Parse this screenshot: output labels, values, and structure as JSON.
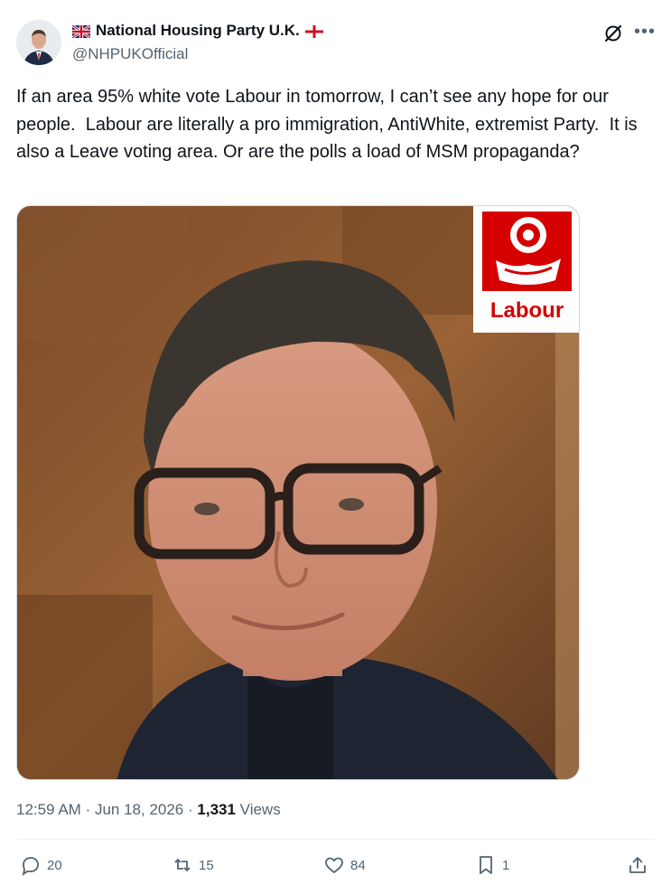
{
  "author": {
    "display_name": "National Housing Party U.K.",
    "handle": "@NHPUKOfficial"
  },
  "tweet": {
    "text": "If an area 95% white vote Labour in tomorrow, I can’t see any hope for our people.  Labour are literally a pro immigration, AntiWhite, extremist Party.  It is also a Leave voting area. Or are the polls a load of MSM propaganda?"
  },
  "media": {
    "logo_text": "Labour",
    "logo_color": "#d50000"
  },
  "meta": {
    "time": "12:59 AM",
    "date": "Jun 18, 2026",
    "views_count": "1,331",
    "views_label": "Views"
  },
  "actions": {
    "replies": "20",
    "reposts": "15",
    "likes": "84",
    "bookmarks": "1"
  }
}
